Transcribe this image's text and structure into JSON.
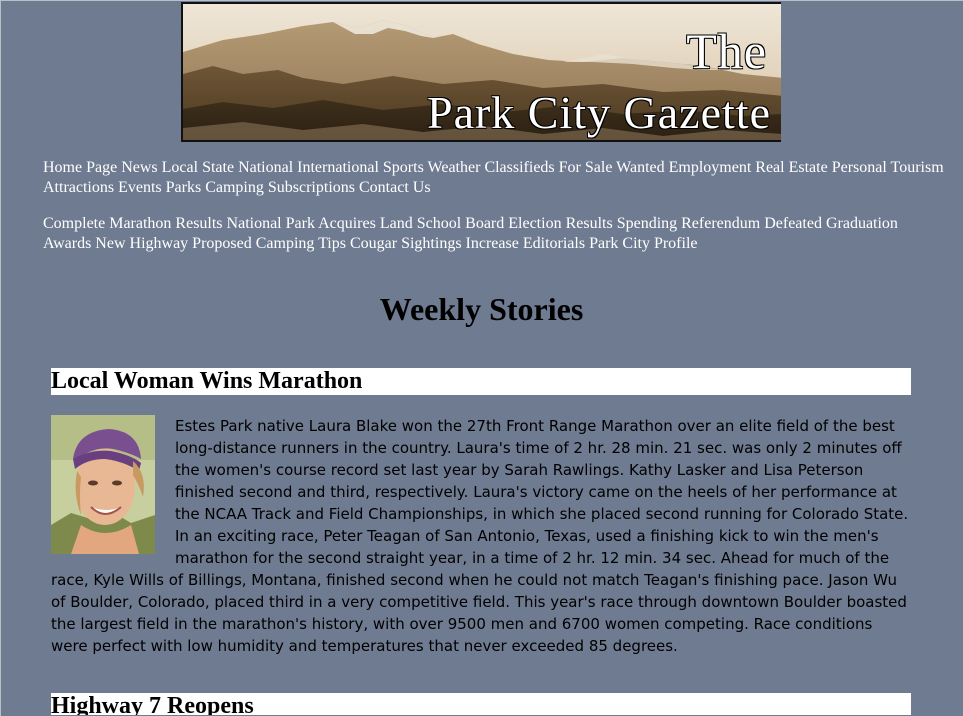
{
  "banner": {
    "the_text": "The",
    "title_text": "Park City Gazette"
  },
  "nav": {
    "sections": [
      "Home Page",
      "News",
      "Local",
      "State",
      "National",
      "International",
      "Sports",
      "Weather",
      "Classifieds",
      "For Sale",
      "Wanted",
      "Employment",
      "Real Estate",
      "Personal",
      "Tourism",
      "Attractions",
      "Events",
      "Parks",
      "Camping",
      "Subscriptions",
      "Contact Us"
    ],
    "stories": [
      "Complete Marathon Results",
      "National Park Acquires Land",
      "School Board Election Results",
      "Spending Referendum Defeated",
      "Graduation Awards",
      "New Highway Proposed",
      "Camping Tips",
      "Cougar Sightings Increase",
      "Editorials",
      "Park City Profile"
    ]
  },
  "main": {
    "section_title": "Weekly Stories",
    "stories": [
      {
        "headline": "Local Woman Wins Marathon",
        "body": "Estes Park native Laura Blake won the 27th Front Range Marathon over an elite field of the best long-distance runners in the country. Laura's time of 2 hr. 28 min. 21 sec. was only 2 minutes off the women's course record set last year by Sarah Rawlings. Kathy Lasker and Lisa Peterson finished second and third, respectively. Laura's victory came on the heels of her performance at the NCAA Track and Field Championships, in which she placed second running for Colorado State. In an exciting race, Peter Teagan of San Antonio, Texas, used a finishing kick to win the men's marathon for the second straight year, in a time of 2 hr. 12 min. 34 sec. Ahead for much of the race, Kyle Wills of Billings, Montana, finished second when he could not match Teagan's finishing pace. Jason Wu of Boulder, Colorado, placed third in a very competitive field. This year's race through downtown Boulder boasted the largest field in the marathon's history, with over 9500 men and 6700 women competing. Race conditions were perfect with low humidity and temperatures that never exceeded 85 degrees."
      },
      {
        "headline": "Highway 7 Reopens"
      }
    ]
  },
  "colors": {
    "page_background": "#6f7b91",
    "headline_background": "#ffffff",
    "nav_text": "#ffffff"
  }
}
